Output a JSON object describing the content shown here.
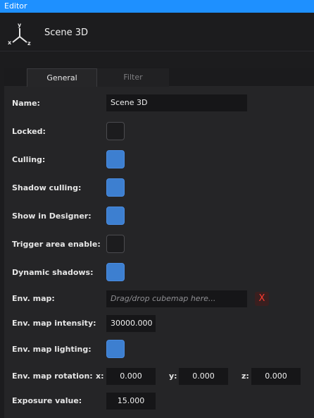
{
  "window": {
    "title": "Editor"
  },
  "header": {
    "title": "Scene 3D",
    "icon": "xyz-axes-icon",
    "axis_letters": {
      "x": "x",
      "y": "y",
      "z": "z"
    }
  },
  "tabs": [
    {
      "label": "General",
      "active": true
    },
    {
      "label": "Filter",
      "active": false
    }
  ],
  "fields": {
    "name": {
      "label": "Name:",
      "value": "Scene 3D"
    },
    "locked": {
      "label": "Locked:",
      "checked": false
    },
    "culling": {
      "label": "Culling:",
      "checked": true
    },
    "shadow_culling": {
      "label": "Shadow culling:",
      "checked": true
    },
    "show_in_designer": {
      "label": "Show in Designer:",
      "checked": true
    },
    "trigger_area": {
      "label": "Trigger area enable:",
      "checked": false
    },
    "dynamic_shadows": {
      "label": "Dynamic shadows:",
      "checked": true
    },
    "env_map": {
      "label": "Env. map:",
      "placeholder": "Drag/drop cubemap here...",
      "clear_label": "X"
    },
    "env_map_intensity": {
      "label": "Env. map intensity:",
      "value": "30000.000"
    },
    "env_map_lighting": {
      "label": "Env. map lighting:",
      "checked": true
    },
    "env_map_rotation": {
      "label": "Env. map rotation:",
      "x_label": "x:",
      "x": "0.000",
      "y_label": "y:",
      "y": "0.000",
      "z_label": "z:",
      "z": "0.000"
    },
    "exposure": {
      "label": "Exposure value:",
      "value": "15.000"
    }
  },
  "colors": {
    "accent": "#1e90ff",
    "checkbox_on": "#3d7fd0",
    "clear_x": "#ff3b30"
  }
}
